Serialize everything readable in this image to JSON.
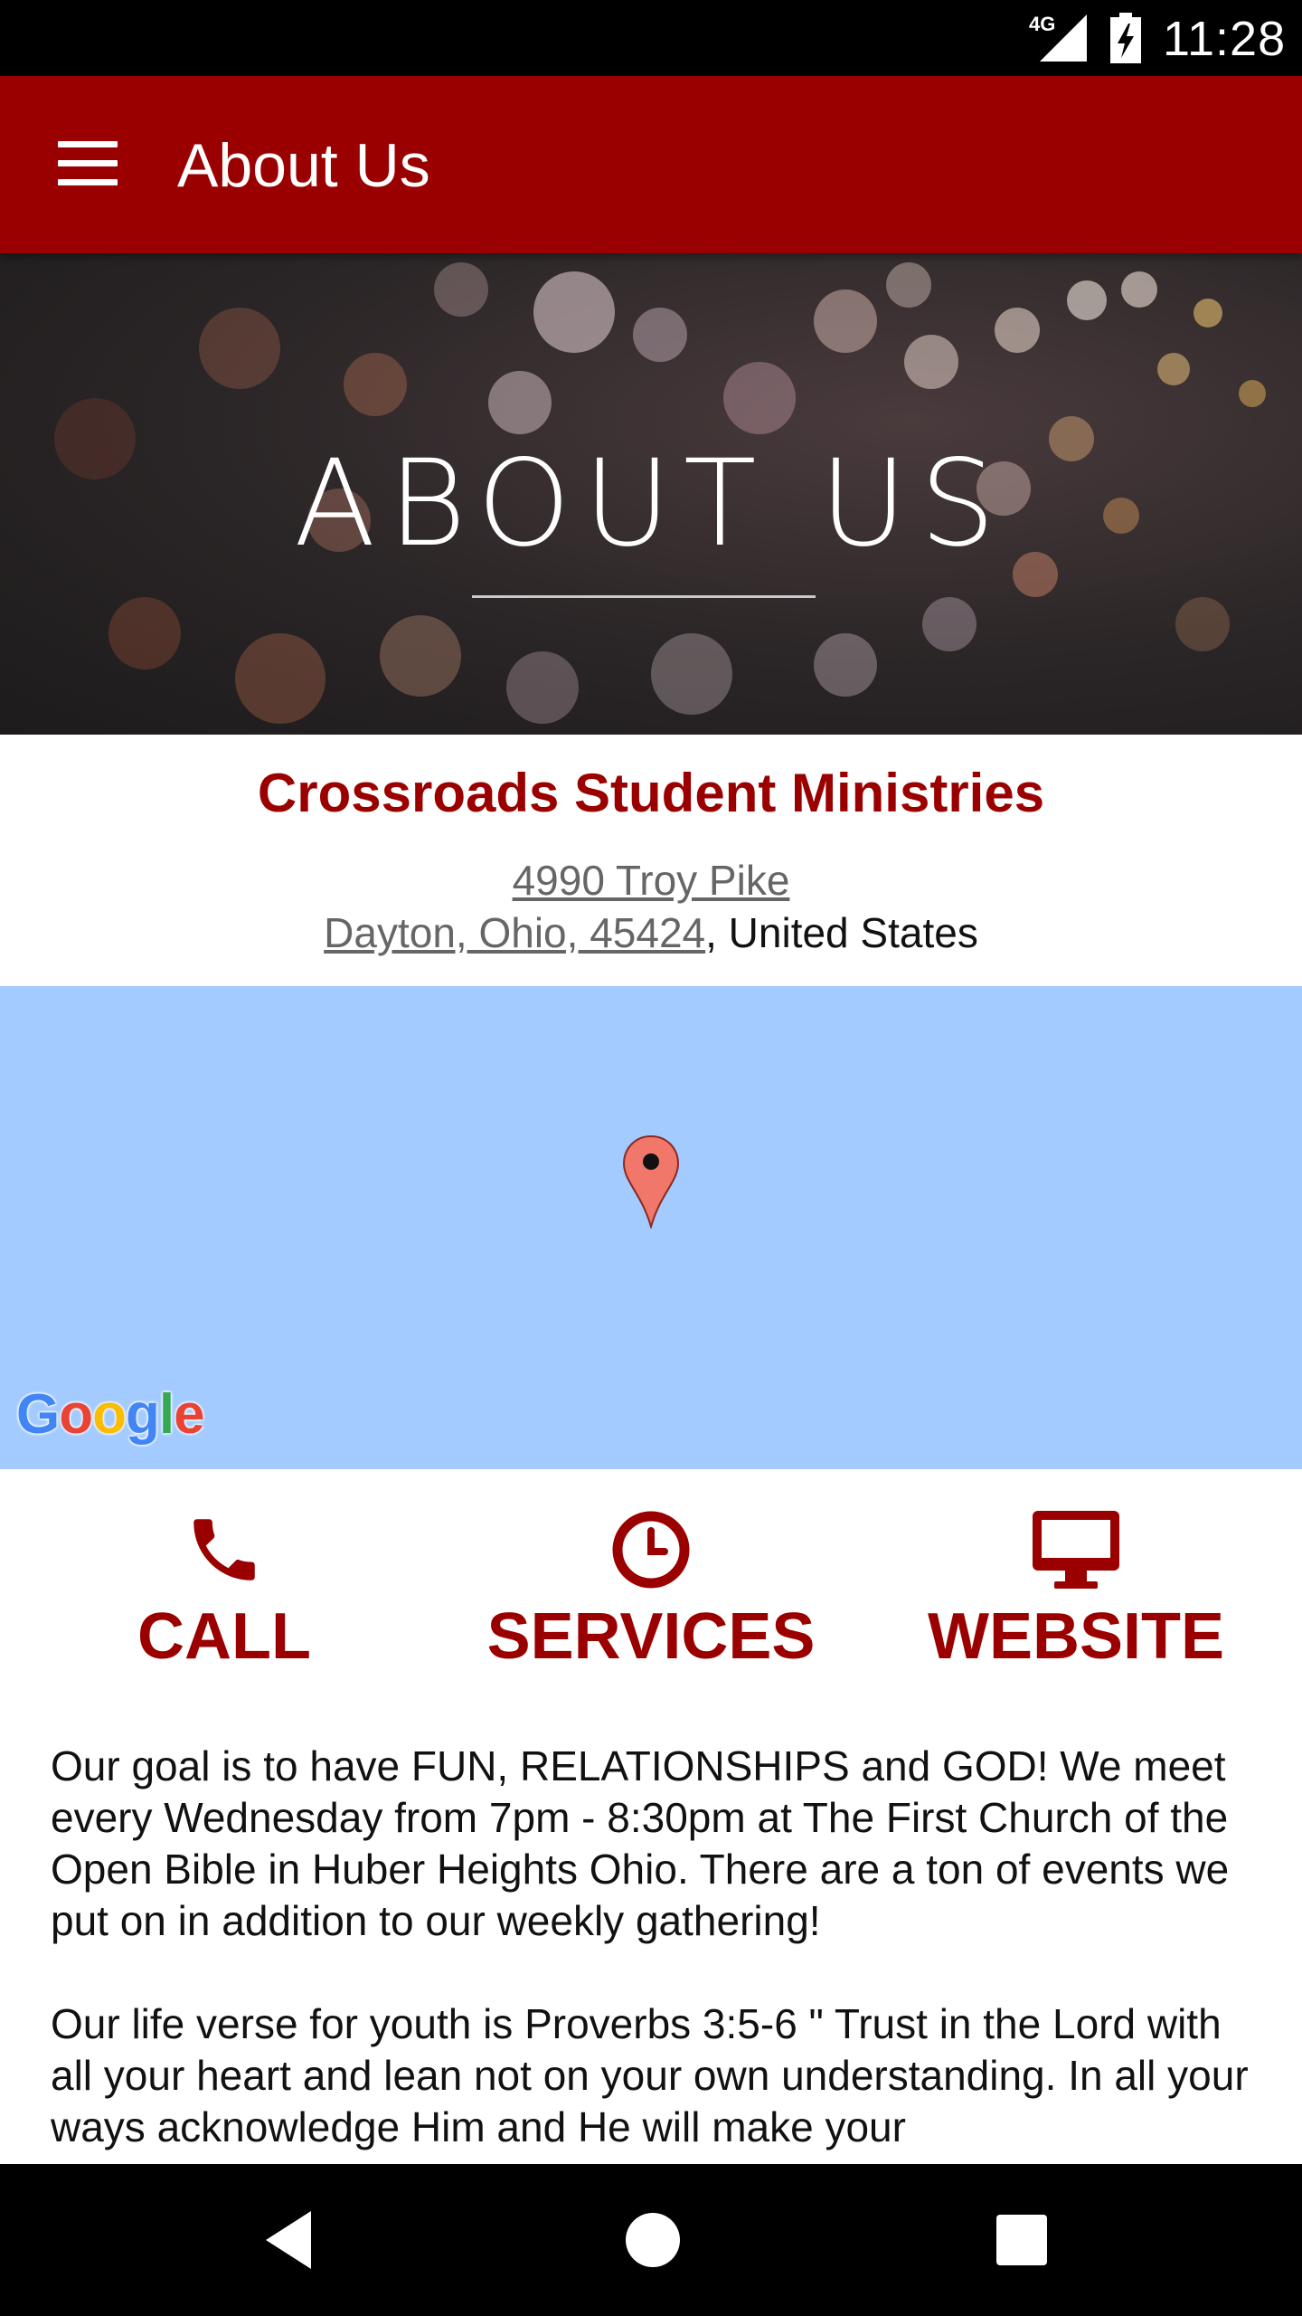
{
  "status_bar": {
    "network": "4G",
    "time": "11:28"
  },
  "app_bar": {
    "title": "About Us",
    "menu_icon": "hamburger-menu-icon"
  },
  "hero": {
    "title": "ABOUT US"
  },
  "organization": {
    "name": "Crossroads Student Ministries",
    "street": "4990 Troy Pike",
    "city_state_zip": "Dayton, Ohio, 45424",
    "country_suffix": ", United States"
  },
  "map": {
    "provider_logo": "Google",
    "marker_icon": "map-pin-icon",
    "background_color": "#a3cbff"
  },
  "actions": [
    {
      "label": "CALL",
      "icon": "phone-icon"
    },
    {
      "label": "SERVICES",
      "icon": "clock-icon"
    },
    {
      "label": "WEBSITE",
      "icon": "monitor-icon"
    }
  ],
  "about": {
    "paragraph_1": "Our goal is to have FUN, RELATIONSHIPS and GOD! We meet every Wednesday from 7pm - 8:30pm at The First Church of the Open Bible in Huber Heights Ohio. There are a ton of events we put on in addition to our weekly gathering!",
    "paragraph_2": "Our life verse for youth is Proverbs 3:5-6 \" Trust in the Lord with all your heart and lean not on your own understanding. In all your ways acknowledge Him and He will make your"
  },
  "nav_bar": {
    "back_icon": "back-triangle-icon",
    "home_icon": "home-circle-icon",
    "recents_icon": "recents-square-icon"
  },
  "colors": {
    "brand": "#9b0000",
    "map": "#a3cbff"
  }
}
